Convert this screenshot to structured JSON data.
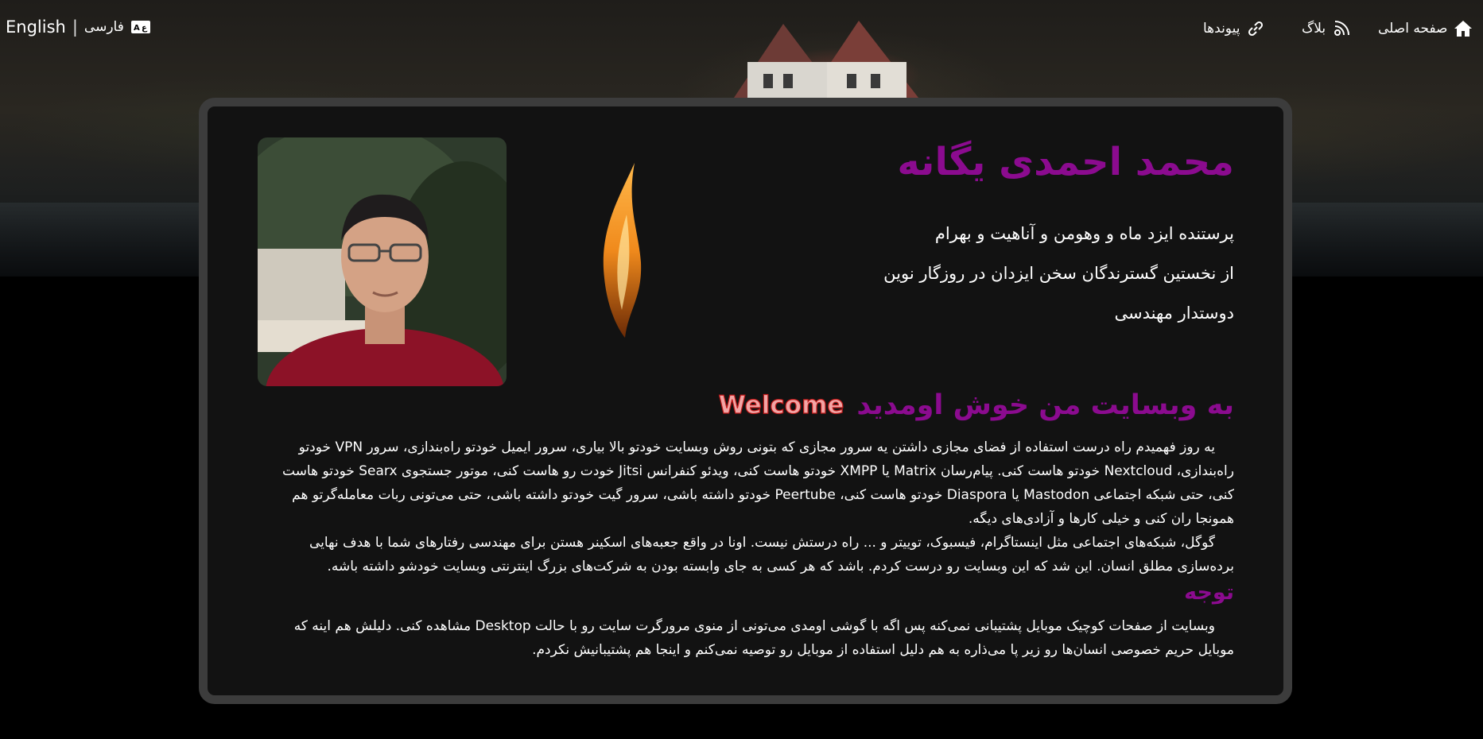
{
  "nav": {
    "home_label": "صفحه اصلی",
    "blog_label": "بلاگ",
    "links_label": "پیوندها"
  },
  "language": {
    "farsi_label": "فارسی",
    "separator": "|",
    "english_label": "English"
  },
  "profile": {
    "name": "محمد احمدی یگانه",
    "taglines": [
      "پرستنده ایزد ماه و وهومن و آناهیت و بهرام",
      "از نخستین گسترندگان سخن ایزدان در روزگار نوین",
      "دوستدار مهندسی"
    ]
  },
  "welcome": {
    "title": "به وبسایت من خوش اومدید",
    "english_word": "Welcome"
  },
  "paragraphs": [
    "یه روز فهمیدم راه درست استفاده از فضای مجازی داشتن یه سرور مجازی که بتونی روش وبسایت خودتو بالا بیاری، سرور ایمیل خودتو راه‌بندازی، سرور VPN خودتو راه‌بندازی، Nextcloud خودتو هاست کنی. پیام‌رسان Matrix یا XMPP خودتو هاست کنی، ویدئو کنفرانس Jitsi خودت رو هاست کنی، موتور جستجوی Searx خودتو هاست کنی، حتی شبکه اجتماعی Mastodon یا Diaspora خودتو هاست کنی، Peertube خودتو داشته باشی، سرور گیت خودتو داشته باشی، حتی می‌تونی ربات معامله‌گرتو هم همونجا ران کنی و خیلی کارها و آزادی‌های دیگه.",
    "گوگل، شبکه‌های اجتماعی مثل اینستاگرام، فیسبوک، توییتر و ... راه درستش نیست. اونا در واقع جعبه‌های اسکینر هستن برای مهندسی رفتارهای شما با هدف نهایی برده‌سازی مطلق انسان. این شد که این وبسایت رو درست کردم. باشد که هر کسی به جای وابسته بودن به شرکت‌های بزرگ اینترنتی وبسایت خودشو داشته باشه."
  ],
  "note": {
    "title": "توجه",
    "text": "وبسایت از صفحات کوچیک موبایل پشتیبانی نمی‌کنه پس اگه با گوشی اومدی می‌تونی از منوی مرورگرت سایت رو با حالت Desktop مشاهده کنی. دلیلش هم اینه که موبایل حریم خصوصی انسان‌ها رو زیر پا می‌ذاره به هم دلیل استفاده از موبایل رو توصیه نمی‌کنم و اینجا هم پشتیبانیش نکردم."
  },
  "colors": {
    "accent": "#8b0b8f",
    "card_bg": "#121212",
    "card_border": "#3c3c3c"
  },
  "icons": [
    "home-icon",
    "blog-icon",
    "links-icon",
    "language-icon"
  ]
}
